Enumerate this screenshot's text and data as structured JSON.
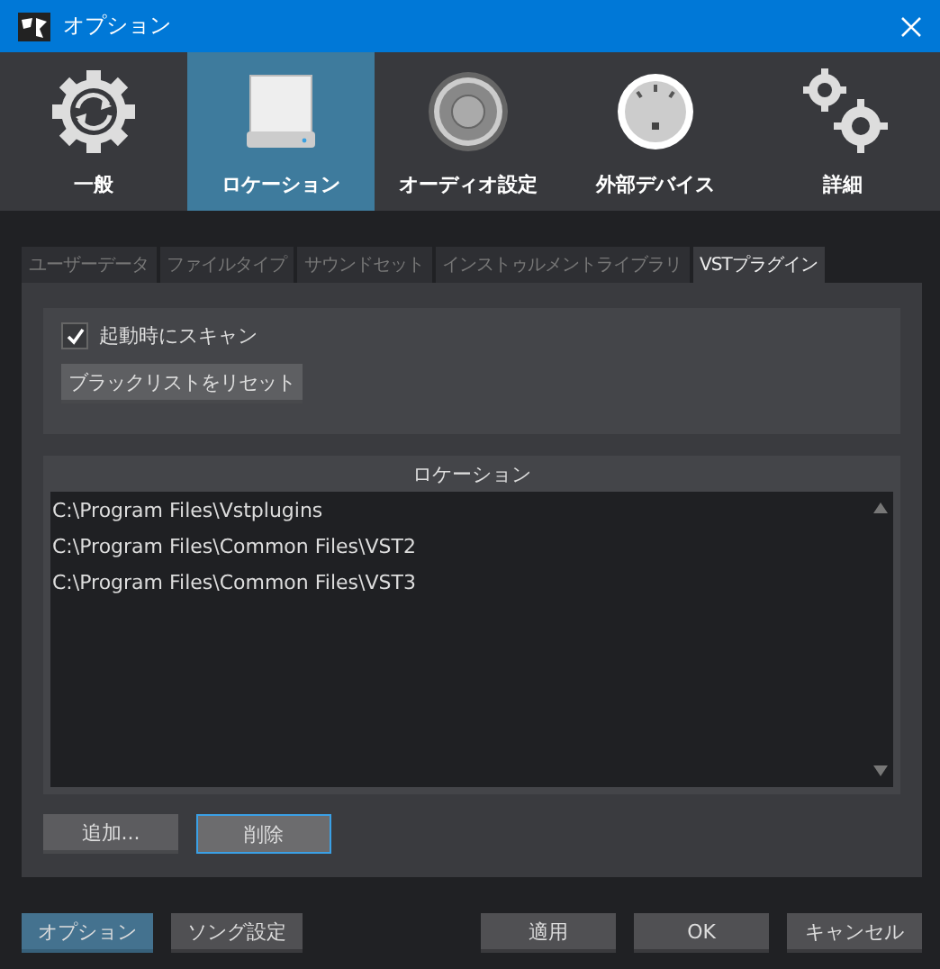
{
  "window": {
    "title": "オプション"
  },
  "categories": [
    {
      "label": "一般",
      "kind": "general",
      "selected": false
    },
    {
      "label": "ロケーション",
      "kind": "drive",
      "selected": true
    },
    {
      "label": "オーディオ設定",
      "kind": "speaker",
      "selected": false
    },
    {
      "label": "外部デバイス",
      "kind": "gauge",
      "selected": false
    },
    {
      "label": "詳細",
      "kind": "gears",
      "selected": false
    }
  ],
  "tabs": [
    {
      "label": "ユーザーデータ",
      "selected": false
    },
    {
      "label": "ファイルタイプ",
      "selected": false
    },
    {
      "label": "サウンドセット",
      "selected": false
    },
    {
      "label": "インストゥルメントライブラリ",
      "selected": false
    },
    {
      "label": "VSTプラグイン",
      "selected": true
    }
  ],
  "scan_checkbox": {
    "label": "起動時にスキャン",
    "checked": true
  },
  "reset_button": {
    "label": "ブラックリストをリセット"
  },
  "locations": {
    "header": "ロケーション",
    "rows": [
      "C:\\Program Files\\Vstplugins",
      "C:\\Program Files\\Common Files\\VST2",
      "C:\\Program Files\\Common Files\\VST3"
    ]
  },
  "list_buttons": [
    {
      "label": "追加...",
      "focused": false
    },
    {
      "label": "削除",
      "focused": true
    }
  ],
  "footer_left": [
    {
      "label": "オプション",
      "selected": true
    },
    {
      "label": "ソング設定",
      "selected": false
    }
  ],
  "footer_right": [
    "適用",
    "OK",
    "キャンセル"
  ]
}
